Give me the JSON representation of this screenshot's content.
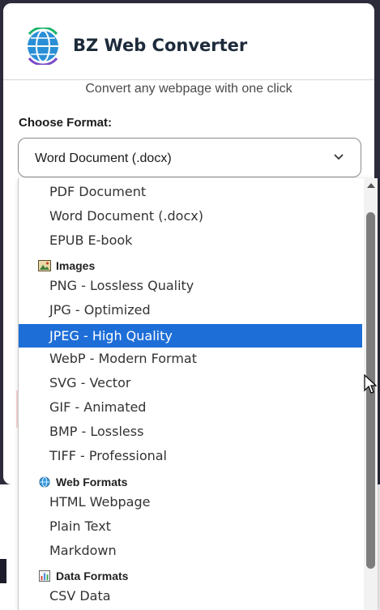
{
  "app": {
    "title": "BZ Web Converter",
    "subtitle": "Convert any webpage with one click"
  },
  "form": {
    "label": "Choose Format:",
    "selected_value": "Word Document (.docx)"
  },
  "dropdown": {
    "document_options": [
      "PDF Document",
      "Word Document (.docx)",
      "EPUB E-book"
    ],
    "groups": [
      {
        "name": "Images",
        "icon": "picture-icon",
        "options": [
          "PNG - Lossless Quality",
          "JPG - Optimized",
          "JPEG - High Quality",
          "WebP - Modern Format",
          "SVG - Vector",
          "GIF - Animated",
          "BMP - Lossless",
          "TIFF - Professional"
        ]
      },
      {
        "name": "Web Formats",
        "icon": "globe-icon",
        "options": [
          "HTML Webpage",
          "Plain Text",
          "Markdown"
        ]
      },
      {
        "name": "Data Formats",
        "icon": "bar-chart-icon",
        "options": [
          "CSV Data"
        ]
      }
    ],
    "highlighted": "JPEG - High Quality"
  },
  "colors": {
    "highlight": "#1e6ed8",
    "title": "#1d2a3a"
  }
}
